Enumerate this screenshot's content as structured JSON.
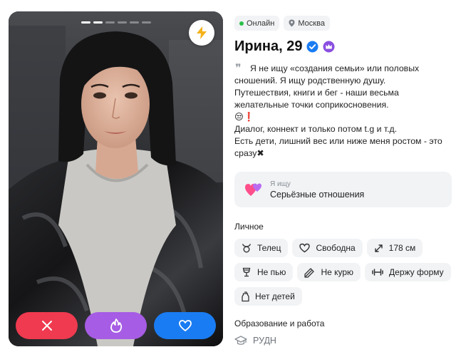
{
  "photo": {
    "total_photos": 6,
    "current_photo": 2,
    "boost_icon": "lightning-icon"
  },
  "actions": {
    "dislike_icon": "close-icon",
    "superlike_icon": "flame-icon",
    "like_icon": "heart-icon",
    "colors": {
      "dislike": "#ef3a4f",
      "superlike": "#a65ce4",
      "like": "#1a7cf2"
    }
  },
  "status": {
    "online_label": "Онлайн",
    "city": "Москва",
    "online_color": "#2cc04a"
  },
  "profile": {
    "name_age": "Ирина, 29",
    "verified_icon": "verified-check-icon",
    "premium_icon": "crown-badge-icon"
  },
  "bio": {
    "quote_icon": "quote-icon",
    "lines": [
      "Я не ищу «создания семьи» или половых",
      "сношений. Я ищу родственную душу.",
      "Путешествия, книги и бег - наши весьма",
      "желательные точки соприкосновения.",
      "😒❗",
      "Диалог, коннект и только потом t.g и т.д.",
      "Есть дети, лишний вес или ниже меня ростом - это",
      "сразу✖"
    ]
  },
  "looking_for": {
    "label": "Я ищу",
    "value": "Серьёзные отношения",
    "icon": "hearts-icon"
  },
  "personal": {
    "title": "Личное",
    "tags": [
      {
        "icon": "taurus-icon",
        "label": "Телец"
      },
      {
        "icon": "heart-outline-icon",
        "label": "Свободна"
      },
      {
        "icon": "height-icon",
        "label": "178 см"
      },
      {
        "icon": "glass-icon",
        "label": "Не пью"
      },
      {
        "icon": "no-smoking-icon",
        "label": "Не курю"
      },
      {
        "icon": "dumbbell-icon",
        "label": "Держу форму"
      },
      {
        "icon": "baby-bottle-icon",
        "label": "Нет детей"
      }
    ]
  },
  "education": {
    "title": "Образование и работа",
    "university": "РУДН",
    "icon": "graduation-cap-icon"
  }
}
